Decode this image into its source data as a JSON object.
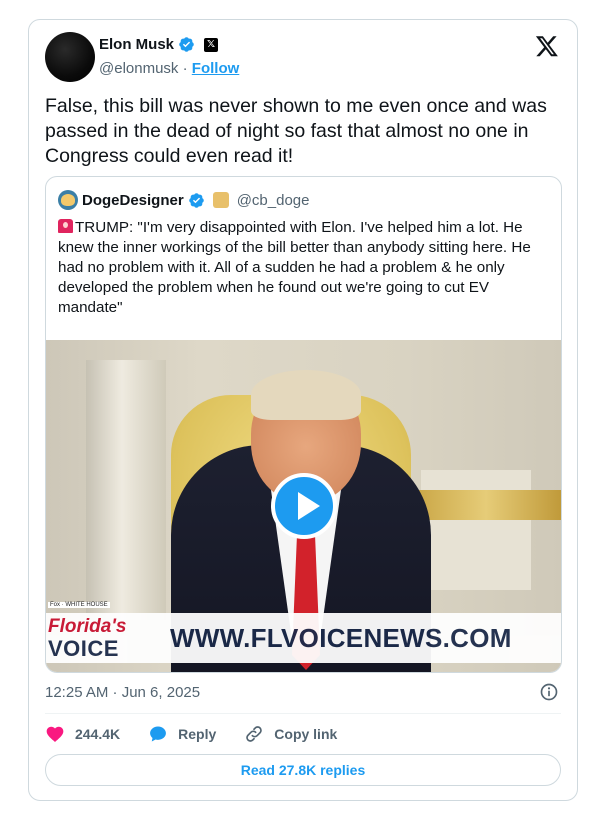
{
  "author": {
    "name": "Elon Musk",
    "handle": "@elonmusk",
    "separator": "·",
    "follow_label": "Follow",
    "badge_letter": "𝕏"
  },
  "tweet": {
    "text": "False, this bill was never shown to me even once and was passed in the dead of night so fast that almost no one in Congress could even read it!"
  },
  "quoted": {
    "name": "DogeDesigner",
    "handle": "@cb_doge",
    "text": "TRUMP: \"I'm very disappointed with Elon. I've helped him a lot. He knew the inner workings of the bill better than anybody sitting here. He had no problem with it. All of a sudden he had a problem & he only developed the problem when he found out we're going to cut EV mandate\"",
    "video": {
      "logo_line1": "Florida's",
      "logo_line2": "VOICE",
      "banner_url": "WWW.FLVOICENEWS.COM",
      "tiny_caption": "Fox · WHITE HOUSE"
    }
  },
  "meta": {
    "timestamp": "12:25 AM · Jun 6, 2025"
  },
  "actions": {
    "like_count": "244.4K",
    "reply_label": "Reply",
    "copy_label": "Copy link"
  },
  "read_replies": "Read 27.8K replies",
  "colors": {
    "accent": "#1d9bf0",
    "like": "#f91880",
    "text": "#0f1419",
    "secondary": "#536471",
    "border": "#cfd9de"
  },
  "icons": [
    "verified-badge-icon",
    "x-logo-icon",
    "siren-icon",
    "play-icon",
    "info-icon",
    "heart-icon",
    "reply-bubble-icon",
    "link-icon"
  ]
}
